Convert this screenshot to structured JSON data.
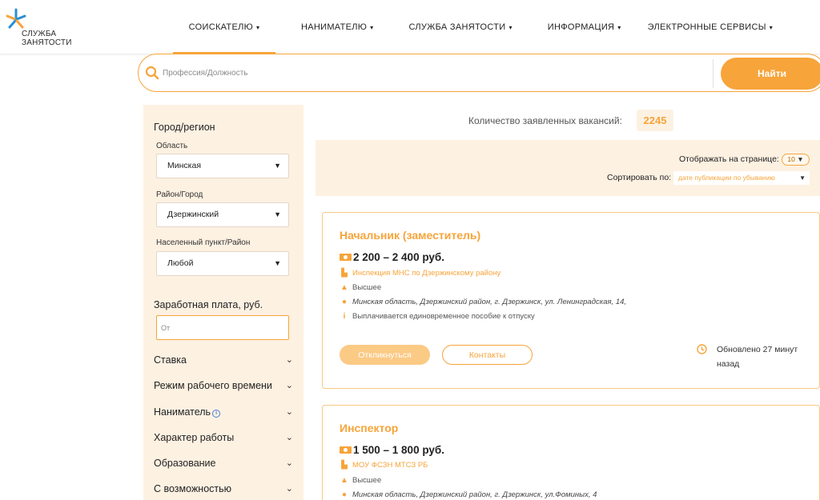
{
  "header": {
    "logo_line1": "СЛУЖБА",
    "logo_line2": "ЗАНЯТОСТИ",
    "nav": [
      {
        "label": "СОИСКАТЕЛЮ"
      },
      {
        "label": "НАНИМАТЕЛЮ"
      },
      {
        "label": "СЛУЖБА ЗАНЯТОСТИ"
      },
      {
        "label": "ИНФОРМАЦИЯ"
      },
      {
        "label": "ЭЛЕКТРОННЫЕ СЕРВИСЫ"
      }
    ],
    "active_nav": "СОИСКАТЕЛЮ"
  },
  "search": {
    "placeholder": "Профессия/Должность",
    "value": "",
    "button_label": "Найти"
  },
  "sidebar": {
    "location_heading": "Город/регион",
    "region_label": "Область",
    "region_value": "Минская",
    "district_label": "Район/Город",
    "district_value": "Дзержинский",
    "locality_label": "Населенный пункт/Район",
    "locality_value": "Любой",
    "salary_heading": "Заработная плата, руб.",
    "salary_placeholder": "От",
    "filters": [
      {
        "label": "Ставка"
      },
      {
        "label": "Режим рабочего времени"
      },
      {
        "label": "Наниматель"
      },
      {
        "label": "Характер работы"
      },
      {
        "label": "Образование"
      },
      {
        "label": "С возможностью"
      }
    ]
  },
  "results": {
    "count_label": "Количество заявленных вакансий:",
    "count_value": "2245",
    "per_page_label": "Отображать на странице:",
    "per_page_value": "10",
    "sort_label": "Сортировать по:",
    "sort_value": "дате публикации по убыванию"
  },
  "vacancies": [
    {
      "title": "Начальник (заместитель)",
      "salary": "2 200 – 2 400 руб.",
      "employer": "Инспекция МНС по Дзержинскому району",
      "education": "Высшее",
      "address": "Минская область, Дзержинский район, г. Дзержинск, ул. Ленинградская, 14,",
      "note": "Выплачивается единовременное пособие к отпуску",
      "respond_label": "Откликнуться",
      "contacts_label": "Контакты",
      "updated": "Обновлено 27 минут назад"
    },
    {
      "title": "Инспектор",
      "salary": "1 500 – 1 800 руб.",
      "employer": "МОУ ФСЗН МТСЗ РБ",
      "education": "Высшее",
      "address": "Минская область, Дзержинский район, г. Дзержинск, ул.Фоминых, 4"
    }
  ],
  "colors": {
    "accent": "#f7a43a",
    "panel": "#fdf1e2",
    "logo_blue": "#2a8fd0"
  }
}
